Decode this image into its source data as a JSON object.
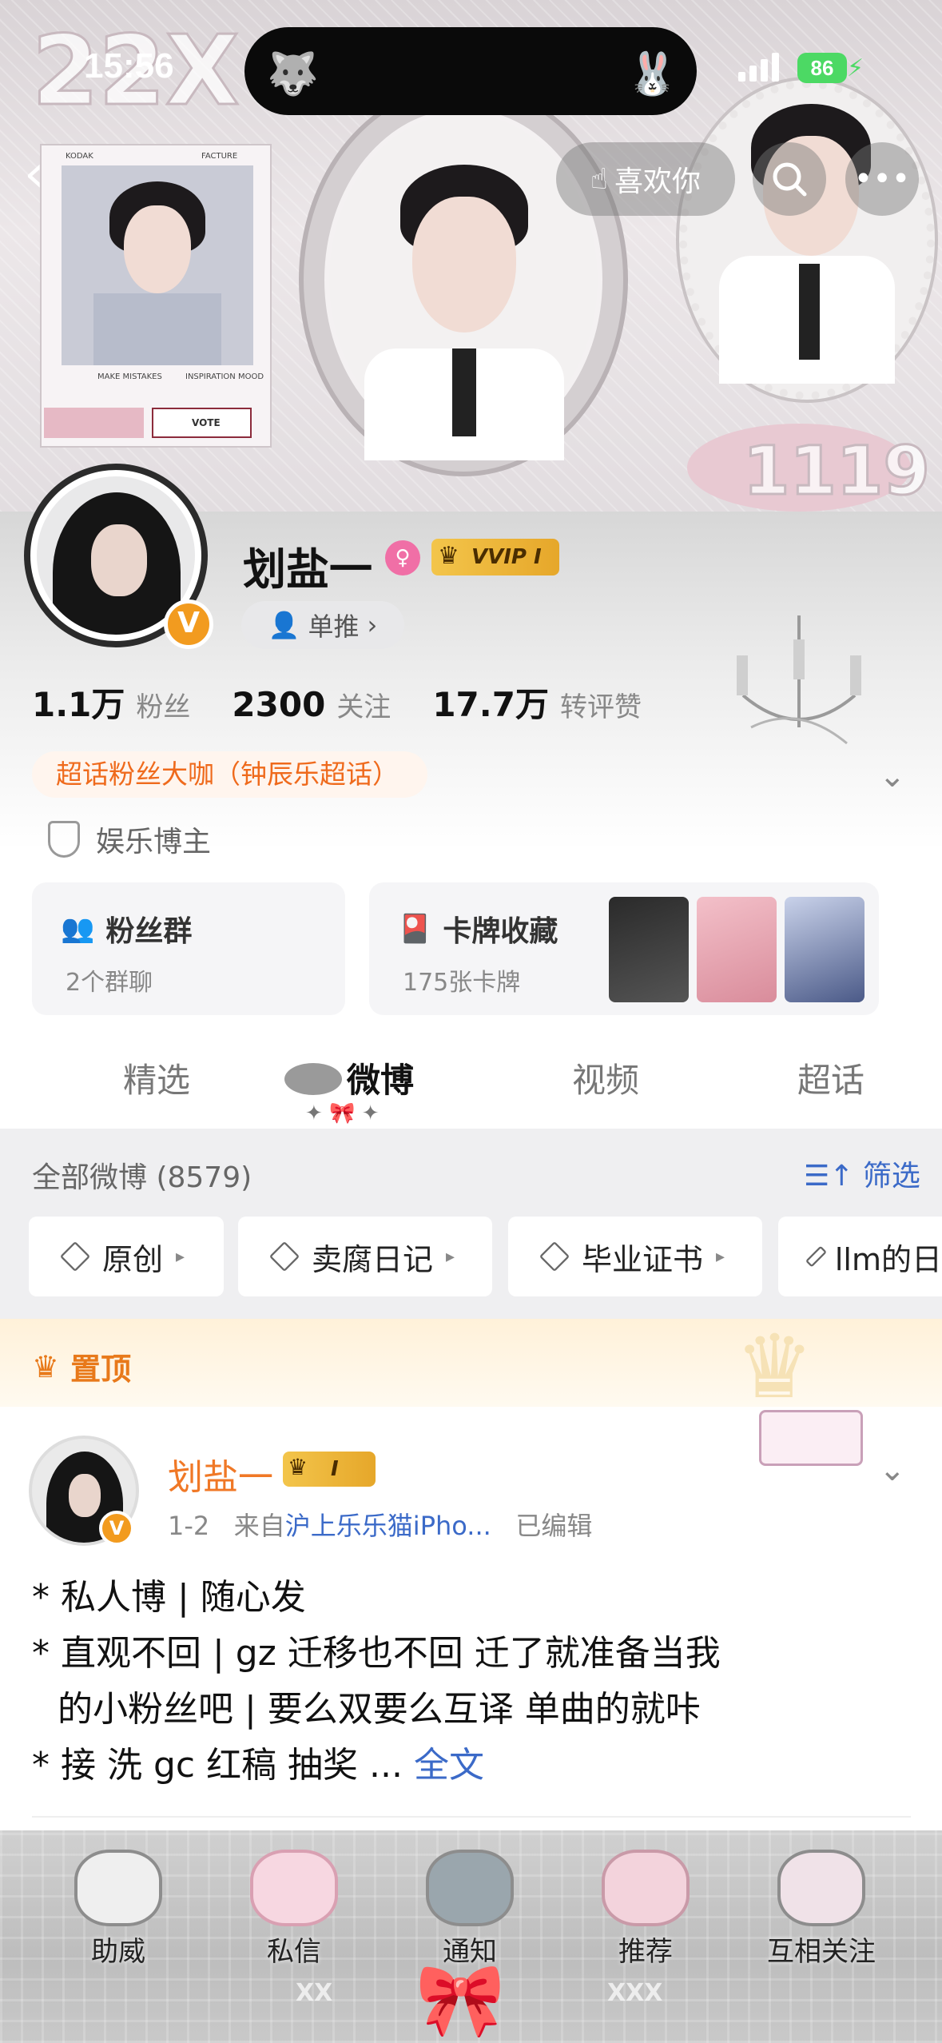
{
  "status_bar": {
    "time": "15:56",
    "battery": "86",
    "left_emoji": "🐺",
    "right_emoji": "🐰"
  },
  "header": {
    "banner_number_left": "22X",
    "banner_number_right": "1119",
    "like_button_label": "喜欢你",
    "polaroid_tags": [
      "KODAK",
      "FACTURE",
      "MAKE MISTAKES",
      "INSPIRATION MOOD",
      "VOTE"
    ]
  },
  "profile": {
    "username": "划盐一",
    "gender_symbol": "♀",
    "vip_label": "VVIP I",
    "dantui_label": "单推",
    "stats": [
      {
        "value": "1.1万",
        "label": "粉丝"
      },
      {
        "value": "2300",
        "label": "关注"
      },
      {
        "value": "17.7万",
        "label": "转评赞"
      }
    ],
    "super_fan_chip": "超话粉丝大咖（钟辰乐超话）",
    "category": "娱乐博主",
    "fan_group": {
      "title": "粉丝群",
      "subtitle": "2个群聊"
    },
    "card_collection": {
      "title": "卡牌收藏",
      "subtitle": "175张卡牌"
    }
  },
  "tabs": [
    {
      "label": "精选",
      "active": false
    },
    {
      "label": "微博",
      "active": true
    },
    {
      "label": "视频",
      "active": false
    },
    {
      "label": "超话",
      "active": false
    }
  ],
  "feed": {
    "all_weibo": "全部微博 (8579)",
    "filter_label": "筛选",
    "filter_chips": [
      "原创",
      "卖腐日记",
      "毕业证书",
      "llm的日"
    ]
  },
  "pinned": {
    "label": "置顶",
    "post": {
      "author": "划盐一",
      "badge": "I",
      "date": "1-2",
      "source_prefix": "来自",
      "source": "沪上乐乐猫iPho...",
      "edited": "已编辑",
      "lines": [
        "* 私人博 | 随心发",
        "* 直观不回 |  gz 迁移也不回 迁了就准备当我",
        "   的小粉丝吧 | 要么双要么互译 单曲的就咔",
        "* 接 洗 gc  红稿 抽奖 ... "
      ],
      "full_text_link": "全文"
    }
  },
  "bottom_nav": [
    {
      "label": "助威",
      "icon": "heart-cage-icon"
    },
    {
      "label": "私信",
      "icon": "bow-icon"
    },
    {
      "label": "通知",
      "icon": "cat-bell-icon"
    },
    {
      "label": "推荐",
      "icon": "cake-icon"
    },
    {
      "label": "互相关注",
      "icon": "potion-heart-icon"
    }
  ],
  "colors": {
    "accent_orange": "#ef6a1c",
    "link_blue": "#3b6ac8",
    "pinned_orange": "#e8791a",
    "vip_gold": "#f3c54b",
    "verified_orange": "#f29b1f"
  }
}
